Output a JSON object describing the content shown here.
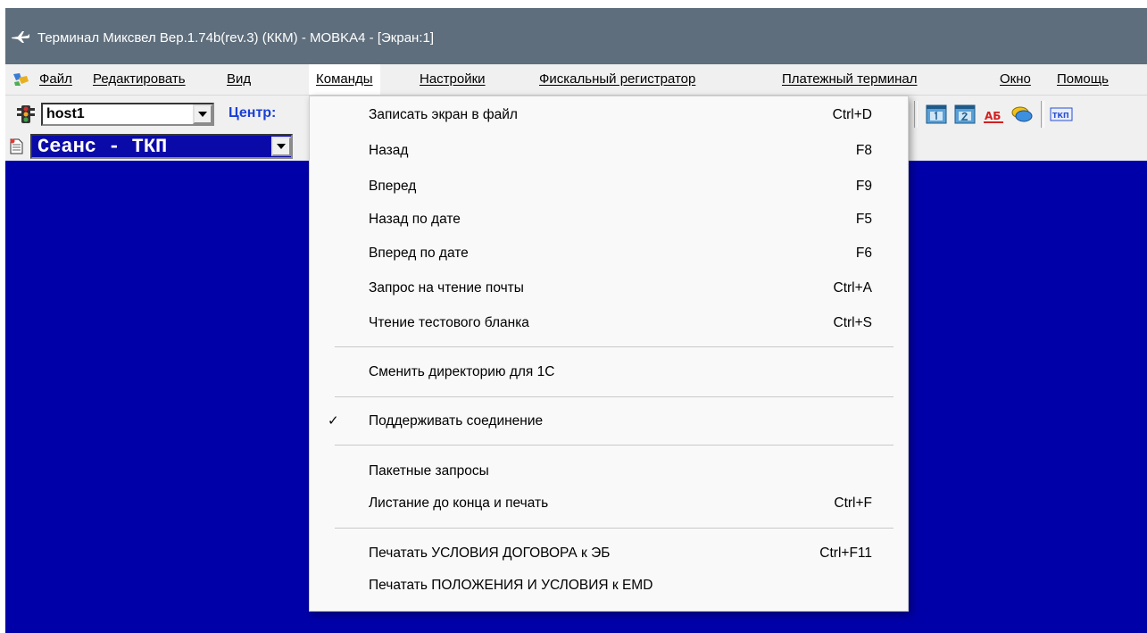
{
  "window": {
    "title": "Терминал Миксвел Вер.1.74b(rev.3) (ККМ) - MOBKA4 - [Экран:1]"
  },
  "menubar": {
    "items": [
      {
        "label": "Файл"
      },
      {
        "label": "Редактировать"
      },
      {
        "label": "Вид"
      },
      {
        "label": "Команды"
      },
      {
        "label": "Настройки"
      },
      {
        "label": "Фискальный регистратор"
      },
      {
        "label": "Платежный терминал"
      },
      {
        "label": "Окно"
      },
      {
        "label": "Помощь"
      }
    ]
  },
  "toolbar": {
    "host_value": "host1",
    "centr_label": "Центр:",
    "icons": [
      "screen1-icon",
      "screen2-icon",
      "ab-icon",
      "chat-icon",
      "tkp-icon"
    ],
    "tkp_text": "ТКП",
    "ab_text": "АБ"
  },
  "session": {
    "value": "Сеанс - ТКП"
  },
  "dropdown": {
    "group1": [
      {
        "label": "Записать экран в файл",
        "shortcut": "Ctrl+D"
      },
      {
        "label": "Назад",
        "shortcut": "F8"
      },
      {
        "label": "Вперед",
        "shortcut": "F9"
      },
      {
        "label": "Назад по дате",
        "shortcut": "F5"
      },
      {
        "label": "Вперед по дате",
        "shortcut": "F6"
      },
      {
        "label": "Запрос на чтение почты",
        "shortcut": "Ctrl+A"
      },
      {
        "label": "Чтение тестового бланка",
        "shortcut": "Ctrl+S"
      }
    ],
    "group2": [
      {
        "label": "Сменить директорию для 1С"
      }
    ],
    "group3": [
      {
        "label": "Поддерживать соединение",
        "checked": "✓"
      }
    ],
    "group4": [
      {
        "label": "Пакетные запросы"
      },
      {
        "label": "Листание до конца и печать",
        "shortcut": "Ctrl+F"
      }
    ],
    "group5": [
      {
        "label": "Печатать УСЛОВИЯ ДОГОВОРА к ЭБ",
        "shortcut": "Ctrl+F11"
      },
      {
        "label": "Печатать ПОЛОЖЕНИЯ И УСЛОВИЯ к EMD"
      }
    ]
  },
  "colors": {
    "titlebar": "#5e6e7c",
    "work_area": "#0000a8",
    "centr_text": "#1a3fd6"
  }
}
